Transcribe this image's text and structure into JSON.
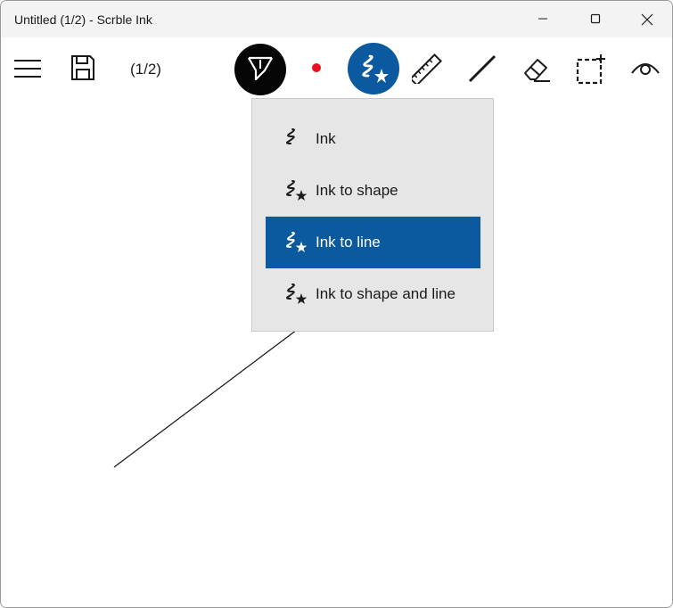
{
  "window": {
    "title": "Untitled (1/2) - Scrble Ink"
  },
  "toolbar": {
    "page_counter": "(1/2)",
    "pen_color": "#e81123"
  },
  "ink_mode_menu": {
    "items": [
      {
        "label": "Ink",
        "icon": "ink-icon",
        "selected": false
      },
      {
        "label": "Ink to shape",
        "icon": "ink-to-shape-icon",
        "selected": false
      },
      {
        "label": "Ink to line",
        "icon": "ink-to-line-icon",
        "selected": true
      },
      {
        "label": "Ink to shape and line",
        "icon": "ink-to-shape-and-line-icon",
        "selected": false
      }
    ]
  },
  "colors": {
    "accent": "#0b5aa0",
    "menu_background": "#e6e6e6",
    "titlebar": "#f3f3f3"
  }
}
